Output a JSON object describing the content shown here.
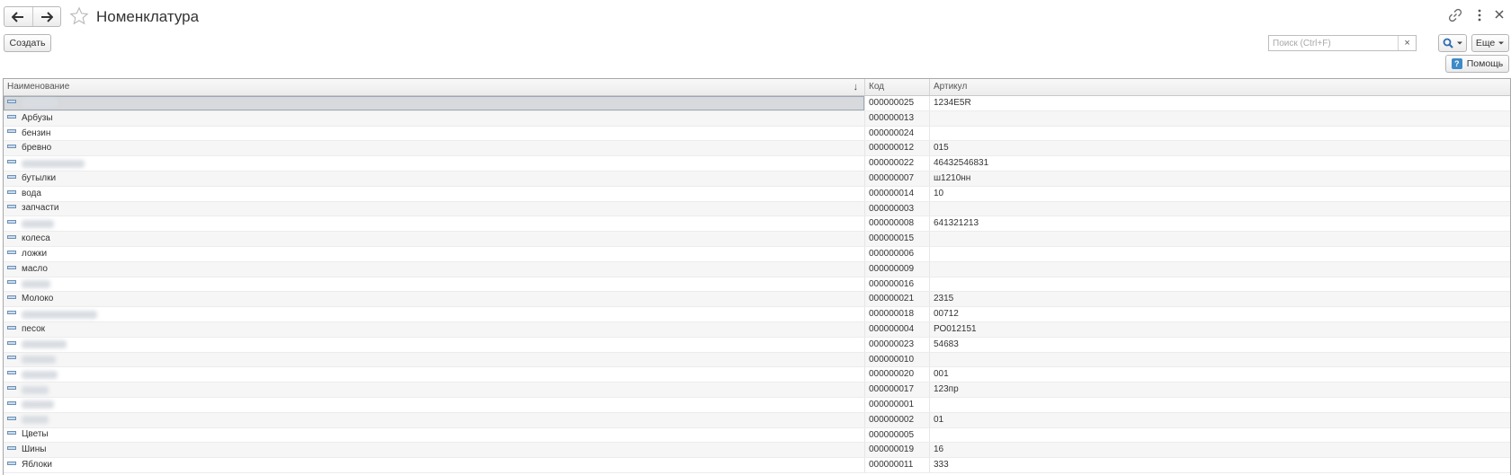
{
  "window": {
    "title": "Номенклатура",
    "icons": {
      "back": "arrow-left-icon",
      "forward": "arrow-right-icon",
      "favorite": "star-icon",
      "link": "link-icon",
      "more": "vertical-dots-icon",
      "close": "close-icon"
    }
  },
  "toolbar": {
    "create_label": "Создать",
    "search_placeholder": "Поиск (Ctrl+F)",
    "search_value": "",
    "clear_label": "×",
    "more_label": "Еще",
    "help_label": "Помощь",
    "help_icon_label": "?"
  },
  "table": {
    "columns": [
      "Наименование",
      "Код",
      "Артикул"
    ],
    "sort_indicator": "↓",
    "rows": [
      {
        "name": "",
        "code": "000000025",
        "article": "1234E5R",
        "selected": true,
        "redacted_width": 40
      },
      {
        "name": "Арбузы",
        "code": "000000013",
        "article": ""
      },
      {
        "name": "бензин",
        "code": "000000024",
        "article": ""
      },
      {
        "name": "бревно",
        "code": "000000012",
        "article": "015"
      },
      {
        "name": "",
        "code": "000000022",
        "article": "46432546831",
        "redacted_width": 70
      },
      {
        "name": "бутылки",
        "code": "000000007",
        "article": "ш1210нн"
      },
      {
        "name": "вода",
        "code": "000000014",
        "article": "10"
      },
      {
        "name": "запчасти",
        "code": "000000003",
        "article": ""
      },
      {
        "name": "",
        "code": "000000008",
        "article": "641321213",
        "redacted_width": 36
      },
      {
        "name": "колеса",
        "code": "000000015",
        "article": ""
      },
      {
        "name": "ложки",
        "code": "000000006",
        "article": ""
      },
      {
        "name": "масло",
        "code": "000000009",
        "article": ""
      },
      {
        "name": "",
        "code": "000000016",
        "article": "",
        "redacted_width": 32
      },
      {
        "name": "Молоко",
        "code": "000000021",
        "article": "2315"
      },
      {
        "name": "",
        "code": "000000018",
        "article": "00712",
        "redacted_width": 84
      },
      {
        "name": "песок",
        "code": "000000004",
        "article": "РО012151"
      },
      {
        "name": "",
        "code": "000000023",
        "article": "54683",
        "redacted_width": 50
      },
      {
        "name": "",
        "code": "000000010",
        "article": "",
        "redacted_width": 38
      },
      {
        "name": "",
        "code": "000000020",
        "article": "001",
        "redacted_width": 40
      },
      {
        "name": "",
        "code": "000000017",
        "article": "123пр",
        "redacted_width": 30
      },
      {
        "name": "",
        "code": "000000001",
        "article": "",
        "redacted_width": 36
      },
      {
        "name": "",
        "code": "000000002",
        "article": "01",
        "redacted_width": 30
      },
      {
        "name": "Цветы",
        "code": "000000005",
        "article": ""
      },
      {
        "name": "Шины",
        "code": "000000019",
        "article": "16"
      },
      {
        "name": "Яблоки",
        "code": "000000011",
        "article": "333"
      }
    ]
  },
  "colors": {
    "selected_row": "#d7d9dc",
    "help_icon": "#3d8ac8",
    "row_icon_border": "#6d8fb3",
    "row_icon_fill": "#c8dcf0"
  }
}
